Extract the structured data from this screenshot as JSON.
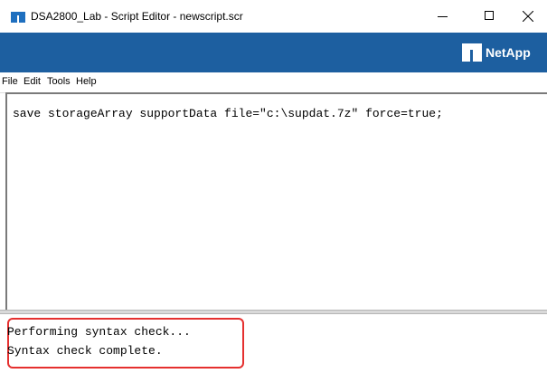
{
  "window": {
    "title": "DSA2800_Lab - Script Editor - newscript.scr",
    "minimize_icon": "minimize-icon",
    "maximize_icon": "maximize-icon",
    "close_icon": "close-icon"
  },
  "brand": {
    "logo_text": "NetApp"
  },
  "menu": {
    "file": "File",
    "edit": "Edit",
    "tools": "Tools",
    "help": "Help"
  },
  "editor": {
    "content": "save storageArray supportData file=\"c:\\supdat.7z\" force=true;"
  },
  "output": {
    "lines": [
      "Performing syntax check...",
      "Syntax check complete."
    ]
  },
  "colors": {
    "brand_bar": "#1d5fa0",
    "highlight_border": "#e5302f"
  }
}
